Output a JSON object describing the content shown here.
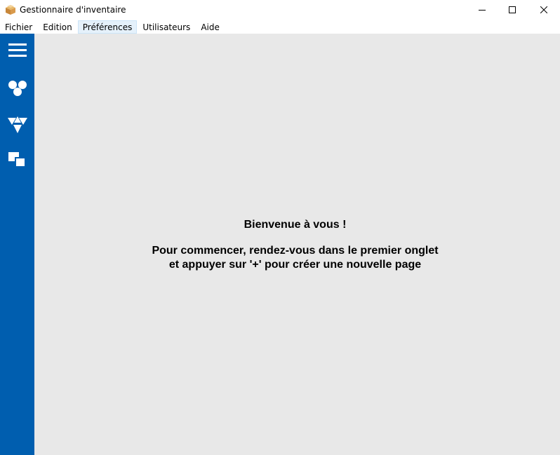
{
  "window": {
    "title": "Gestionnaire d'inventaire",
    "icon": "package-icon",
    "controls": {
      "minimize": "minimize-icon",
      "maximize": "maximize-icon",
      "close": "close-icon"
    }
  },
  "menu": {
    "items": [
      {
        "label": "Fichier"
      },
      {
        "label": "Edition"
      },
      {
        "label": "Préférences",
        "highlighted": true
      },
      {
        "label": "Utilisateurs"
      },
      {
        "label": "Aide"
      }
    ]
  },
  "sidebar": {
    "color": "#005eaf",
    "buttons": [
      {
        "icon": "hamburger-menu-icon"
      },
      {
        "icon": "circles-icon"
      },
      {
        "icon": "triangles-icon"
      },
      {
        "icon": "squares-icon"
      }
    ]
  },
  "main": {
    "background": "#e8e8e8",
    "welcome_title": "Bienvenue à vous !",
    "instruction_line1": "Pour commencer, rendez-vous dans le premier onglet",
    "instruction_line2": "et appuyer sur '+' pour créer une nouvelle page"
  }
}
